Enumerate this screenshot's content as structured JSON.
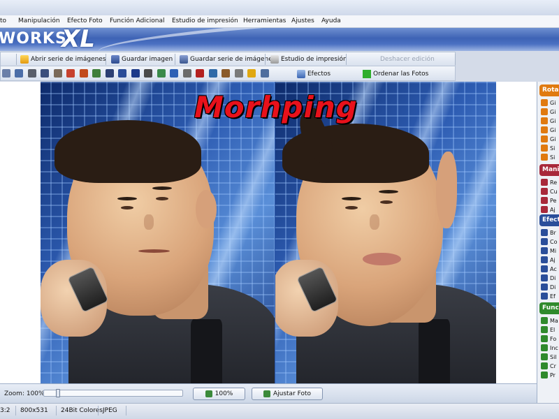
{
  "menubar": {
    "items": [
      "to",
      "Manipulación",
      "Efecto Foto",
      "Función Adicional",
      "Estudio de impresión",
      "Herramientas",
      "Ajustes",
      "Ayuda"
    ]
  },
  "banner": {
    "logo_text": "WORKS",
    "logo_xl": "XL"
  },
  "toolbar": {
    "open_series": "Abrir serie de imágenes",
    "save_image": "Guardar imagen",
    "save_series": "Guardar serie de imágenes",
    "print_studio": "Estudio de impresión",
    "undo": "Deshacer edición",
    "effects": "Efectos",
    "order_photos": "Ordenar las Fotos"
  },
  "canvas": {
    "title": "Morhping"
  },
  "sidebar": {
    "sections": [
      {
        "title": "Rotac",
        "color": "#e07a10",
        "items": [
          "Gi",
          "Gi",
          "Gi",
          "Gi",
          "Gi",
          "Si",
          "Si"
        ]
      },
      {
        "title": "Manip",
        "color": "#a8283a",
        "items": [
          "Re",
          "Cu",
          "Pe",
          "Aj"
        ]
      },
      {
        "title": "Efecto",
        "color": "#2a4e9a",
        "items": [
          "Br",
          "Co",
          "Mi",
          "Aj",
          "Ac",
          "Di",
          "Di",
          "Ef"
        ]
      },
      {
        "title": "Funci",
        "color": "#2f8a2c",
        "items": [
          "Ma",
          "El",
          "Fo",
          "Inc",
          "Sil",
          "Cr",
          "Pr"
        ]
      }
    ]
  },
  "bottombar": {
    "zoom_label": "Zoom: 100%",
    "zoom_level_percent": 100,
    "btn_100": "100%",
    "btn_fit": "Ajustar Foto"
  },
  "statusbar": {
    "index": "3:2",
    "dimensions": "800x531",
    "color_depth": "24Bit Colores",
    "format": "JPEG"
  }
}
